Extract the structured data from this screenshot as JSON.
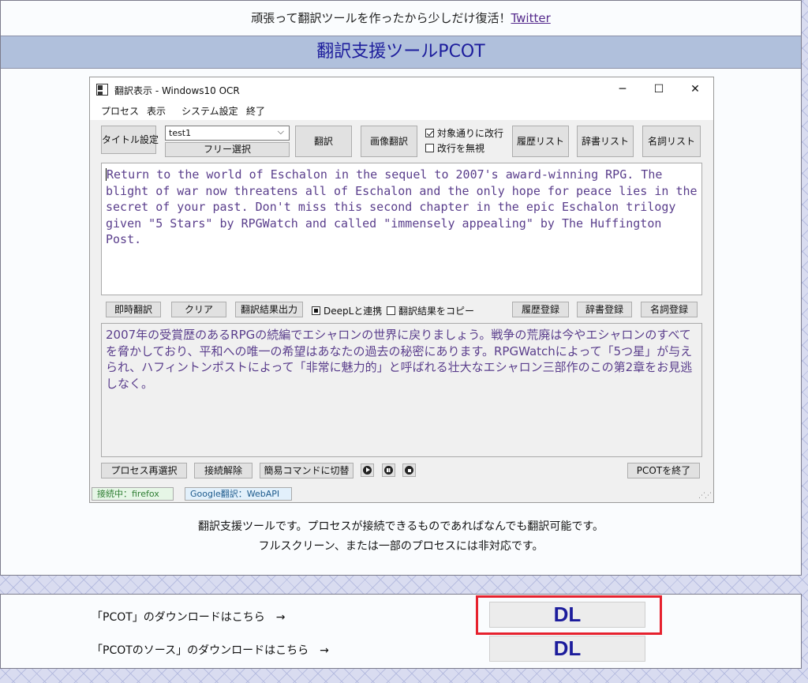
{
  "announcement": {
    "text": "頑張って翻訳ツールを作ったから少しだけ復活！",
    "link": "Twitter"
  },
  "page_title": "翻訳支援ツールPCOT",
  "app": {
    "window_title": "翻訳表示 - Windows10 OCR",
    "controls": {
      "minimize": "─",
      "maximize": "☐",
      "close": "✕"
    },
    "menu": [
      "プロセス",
      "表示",
      "システム設定",
      "終了"
    ],
    "toolbar": {
      "title_setting": "タイトル設定",
      "combo_value": "test1",
      "free_select": "フリー選択",
      "translate": "翻訳",
      "image_translate": "画像翻訳",
      "wrap_by_target": "対象通りに改行",
      "ignore_newline": "改行を無視",
      "history_list": "履歴リスト",
      "dict_list": "辞書リスト",
      "noun_list": "名詞リスト"
    },
    "source_text": "Return to the world of Eschalon in the sequel to 2007's award-winning RPG. The blight of war now threatens all of Eschalon and the only hope for peace lies in the secret of your past. Don't miss this second chapter in the epic Eschalon trilogy given \"5 Stars\" by RPGWatch and called \"immensely appealing\" by The Huffington Post.",
    "middle_bar": {
      "instant_translate": "即時翻訳",
      "clear": "クリア",
      "output_result": "翻訳結果出力",
      "deepl_link": "DeepLと連携",
      "copy_result": "翻訳結果をコピー",
      "register_history": "履歴登録",
      "register_dict": "辞書登録",
      "register_noun": "名詞登録"
    },
    "translated_text": "2007年の受賞歴のあるRPGの続編でエシャロンの世界に戻りましょう。戦争の荒廃は今やエシャロンのすべてを脅かしており、平和への唯一の希望はあなたの過去の秘密にあります。RPGWatchによって「5つ星」が与えられ、ハフィントンポストによって「非常に魅力的」と呼ばれる壮大なエシャロン三部作のこの第2章をお見逃しなく。",
    "bottom_bar": {
      "reselect_process": "プロセス再選択",
      "disconnect": "接続解除",
      "simple_command": "簡易コマンドに切替",
      "exit": "PCOTを終了"
    },
    "status": {
      "connected": "接続中：firefox",
      "engine": "Google翻訳：WebAPI"
    }
  },
  "description": [
    "翻訳支援ツールです。プロセスが接続できるものであればなんでも翻訳可能です。",
    "フルスクリーン、または一部のプロセスには非対応です。"
  ],
  "downloads": [
    {
      "label": "「PCOT」のダウンロードはこちら　→",
      "button": "DL"
    },
    {
      "label": "「PCOTのソース」のダウンロードはこちら　→",
      "button": "DL"
    }
  ]
}
